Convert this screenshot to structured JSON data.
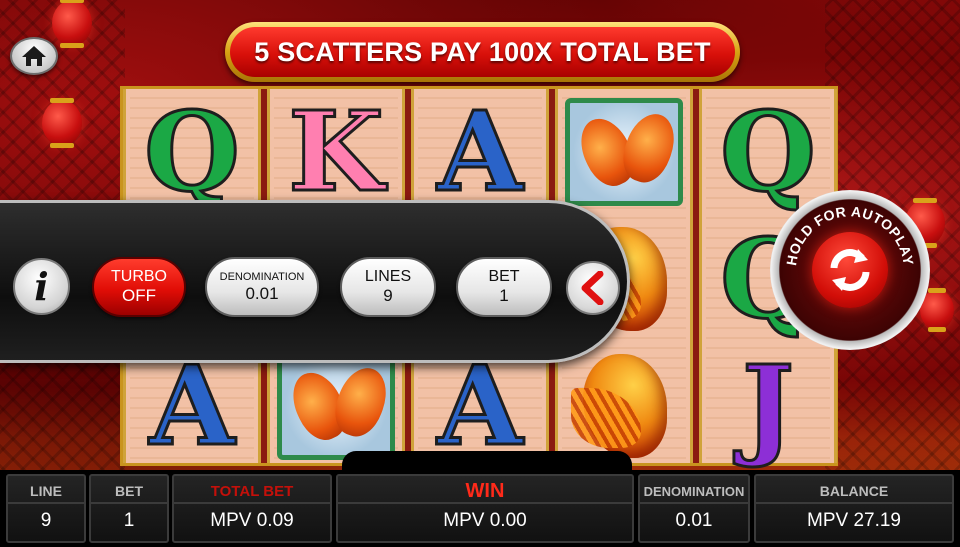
{
  "banner": {
    "text": "5 SCATTERS PAY 100X TOTAL BET"
  },
  "home": {
    "icon": "home-icon"
  },
  "reels": [
    {
      "symbols": [
        "Q",
        "",
        "A"
      ]
    },
    {
      "symbols": [
        "K",
        "",
        ""
      ]
    },
    {
      "symbols": [
        "A",
        "",
        "A"
      ]
    },
    {
      "symbols": [
        "",
        "",
        ""
      ]
    },
    {
      "symbols": [
        "Q",
        "Q",
        "J"
      ]
    }
  ],
  "controls": {
    "info_label": "i",
    "turbo": {
      "line1": "TURBO",
      "line2": "OFF"
    },
    "denomination": {
      "label": "DENOMINATION",
      "value": "0.01"
    },
    "lines": {
      "label": "LINES",
      "value": "9"
    },
    "bet": {
      "label": "BET",
      "value": "1"
    },
    "collapse_icon": "chevron-left-icon"
  },
  "autoplay": {
    "label": "HOLD FOR AUTOPLAY",
    "icon": "refresh-icon"
  },
  "stats": {
    "line": {
      "label": "LINE",
      "value": "9"
    },
    "bet": {
      "label": "BET",
      "value": "1"
    },
    "total_bet": {
      "label": "TOTAL BET",
      "value": "MPV 0.09"
    },
    "win": {
      "label": "WIN",
      "value": "MPV 0.00"
    },
    "denomination": {
      "label": "DENOMINATION",
      "value": "0.01"
    },
    "balance": {
      "label": "BALANCE",
      "value": "MPV 27.19"
    }
  },
  "colors": {
    "accent_red": "#e10d06",
    "gold": "#d7a214",
    "win_red": "#ff2a1a"
  }
}
